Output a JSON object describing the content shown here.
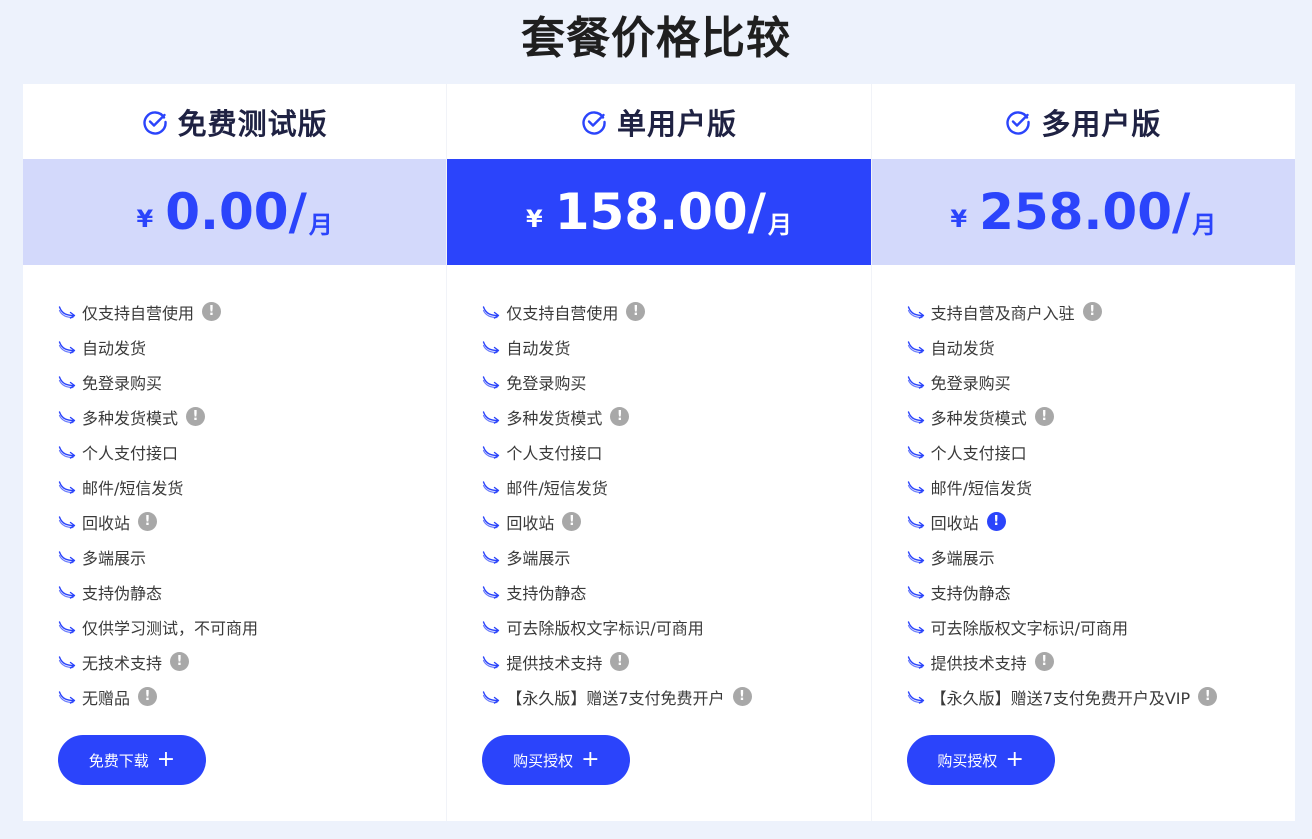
{
  "page_title": "套餐价格比较",
  "colors": {
    "accent": "#2b44fb",
    "price_band_light": "#d3d9fb",
    "background": "#edf2fc",
    "info_gray": "#a8a8a8"
  },
  "plans": [
    {
      "name": "免费测试版",
      "currency": "¥",
      "price": "0.00",
      "slash": "/",
      "unit": "月",
      "featured": false,
      "button_label": "免费下载",
      "button_icon": "+",
      "features": [
        {
          "text": "仅支持自营使用",
          "info": "gray"
        },
        {
          "text": "自动发货",
          "info": null
        },
        {
          "text": "免登录购买",
          "info": null
        },
        {
          "text": "多种发货模式",
          "info": "gray"
        },
        {
          "text": "个人支付接口",
          "info": null
        },
        {
          "text": "邮件/短信发货",
          "info": null
        },
        {
          "text": "回收站",
          "info": "gray"
        },
        {
          "text": "多端展示",
          "info": null
        },
        {
          "text": "支持伪静态",
          "info": null
        },
        {
          "text": "仅供学习测试，不可商用",
          "info": null
        },
        {
          "text": "无技术支持",
          "info": "gray"
        },
        {
          "text": "无赠品",
          "info": "gray"
        }
      ]
    },
    {
      "name": "单用户版",
      "currency": "¥",
      "price": "158.00",
      "slash": "/",
      "unit": "月",
      "featured": true,
      "button_label": "购买授权",
      "button_icon": "+",
      "features": [
        {
          "text": "仅支持自营使用",
          "info": "gray"
        },
        {
          "text": "自动发货",
          "info": null
        },
        {
          "text": "免登录购买",
          "info": null
        },
        {
          "text": "多种发货模式",
          "info": "gray"
        },
        {
          "text": "个人支付接口",
          "info": null
        },
        {
          "text": "邮件/短信发货",
          "info": null
        },
        {
          "text": "回收站",
          "info": "gray"
        },
        {
          "text": "多端展示",
          "info": null
        },
        {
          "text": "支持伪静态",
          "info": null
        },
        {
          "text": "可去除版权文字标识/可商用",
          "info": null
        },
        {
          "text": "提供技术支持",
          "info": "gray"
        },
        {
          "text": "【永久版】赠送7支付免费开户",
          "info": "gray"
        }
      ]
    },
    {
      "name": "多用户版",
      "currency": "¥",
      "price": "258.00",
      "slash": "/",
      "unit": "月",
      "featured": false,
      "button_label": "购买授权",
      "button_icon": "+",
      "features": [
        {
          "text": "支持自营及商户入驻",
          "info": "gray"
        },
        {
          "text": "自动发货",
          "info": null
        },
        {
          "text": "免登录购买",
          "info": null
        },
        {
          "text": "多种发货模式",
          "info": "gray"
        },
        {
          "text": "个人支付接口",
          "info": null
        },
        {
          "text": "邮件/短信发货",
          "info": null
        },
        {
          "text": "回收站",
          "info": "blue"
        },
        {
          "text": "多端展示",
          "info": null
        },
        {
          "text": "支持伪静态",
          "info": null
        },
        {
          "text": "可去除版权文字标识/可商用",
          "info": null
        },
        {
          "text": "提供技术支持",
          "info": "gray"
        },
        {
          "text": "【永久版】赠送7支付免费开户及VIP",
          "info": "gray"
        }
      ]
    }
  ]
}
